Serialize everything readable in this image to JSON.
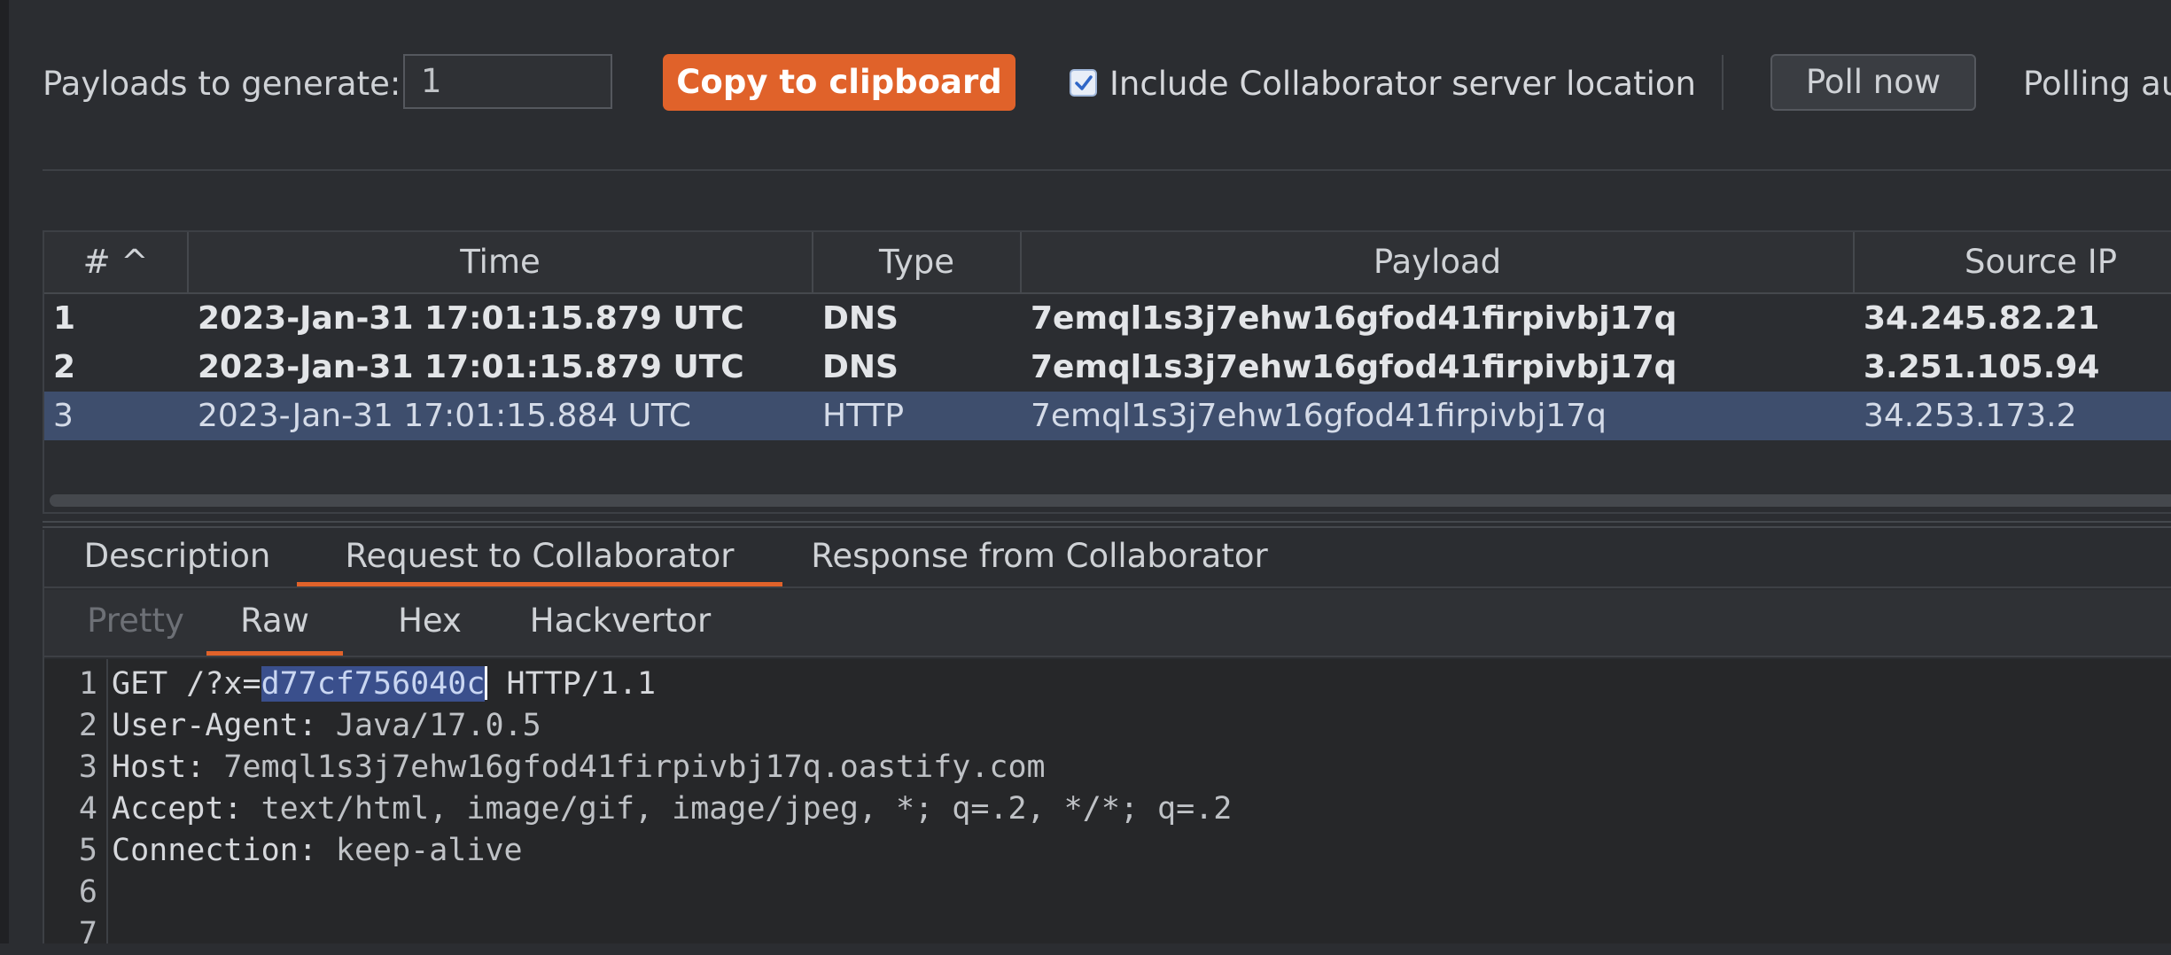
{
  "toolbar": {
    "payloads_label": "Payloads to generate:",
    "payloads_count": "1",
    "copy_button": "Copy to clipboard",
    "include_location_checked": true,
    "include_location_label": "Include Collaborator server location",
    "poll_button": "Poll now",
    "polling_label": "Polling au"
  },
  "table": {
    "columns": [
      "# ^",
      "Time",
      "Type",
      "Payload",
      "Source IP"
    ],
    "rows": [
      {
        "num": "1",
        "time": "2023-Jan-31 17:01:15.879 UTC",
        "type": "DNS",
        "payload": "7emql1s3j7ehw16gfod41firpivbj17q",
        "source_ip": "34.245.82.21",
        "bold": true,
        "selected": false
      },
      {
        "num": "2",
        "time": "2023-Jan-31 17:01:15.879 UTC",
        "type": "DNS",
        "payload": "7emql1s3j7ehw16gfod41firpivbj17q",
        "source_ip": "3.251.105.94",
        "bold": true,
        "selected": false
      },
      {
        "num": "3",
        "time": "2023-Jan-31 17:01:15.884 UTC",
        "type": "HTTP",
        "payload": "7emql1s3j7ehw16gfod41firpivbj17q",
        "source_ip": "34.253.173.2",
        "bold": false,
        "selected": true
      }
    ]
  },
  "detail": {
    "tabs": [
      "Description",
      "Request to Collaborator",
      "Response from Collaborator"
    ],
    "active_tab": 1,
    "subtabs": [
      "Pretty",
      "Raw",
      "Hex",
      "Hackvertor"
    ],
    "active_subtab": 1,
    "editor": {
      "line_numbers": [
        "1",
        "2",
        "3",
        "4",
        "5",
        "6",
        "7"
      ],
      "line1": {
        "method": "GET /?x=",
        "selected": "d77cf756040c",
        "rest": " HTTP/1.1"
      },
      "line2": {
        "key": "User-Agent:",
        "value": " Java/17.0.5"
      },
      "line3": {
        "key": "Host:",
        "value": " 7emql1s3j7ehw16gfod41firpivbj17q.oastify.com"
      },
      "line4": {
        "key": "Accept:",
        "value": " text/html, image/gif, image/jpeg, *; q=.2, */*; q=.2"
      },
      "line5": {
        "key": "Connection:",
        "value": " keep-alive"
      }
    }
  },
  "colors": {
    "background": "#2b2d31",
    "accent": "#e0622a",
    "selection_row": "#3e4e6d",
    "text_selection": "#3a4f8c"
  }
}
